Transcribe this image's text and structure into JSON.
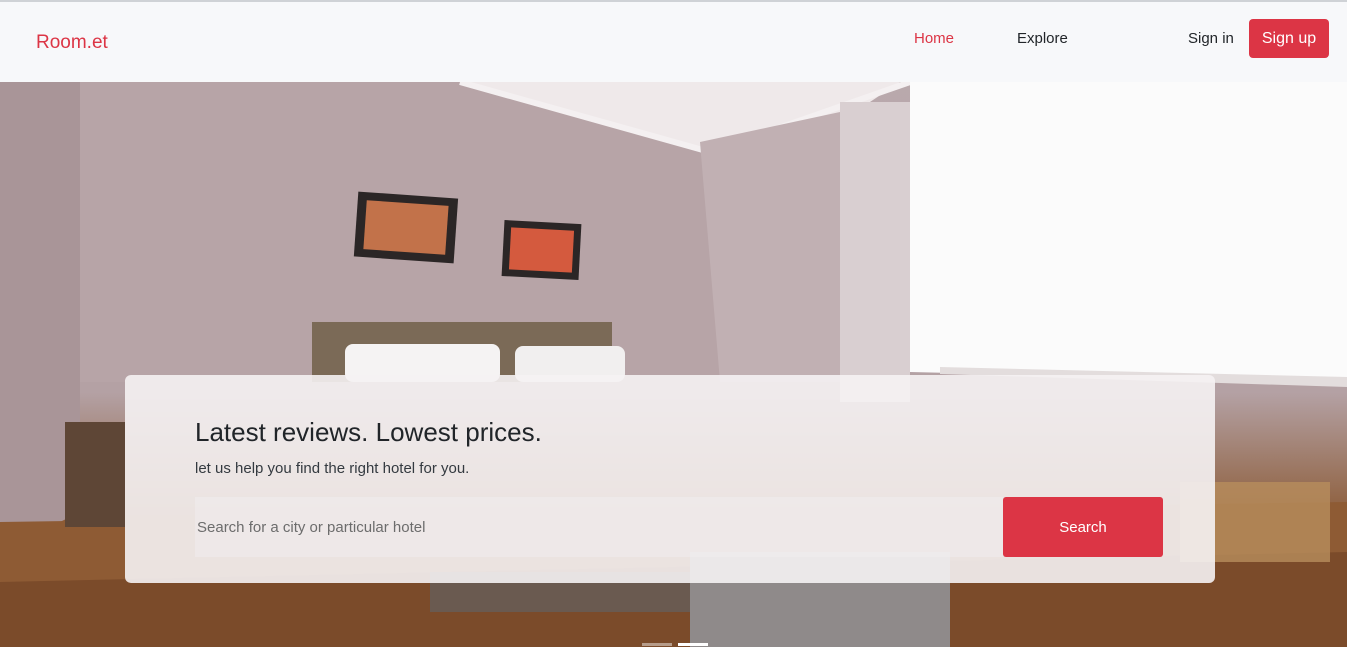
{
  "brand": "Room.et",
  "nav": {
    "home": "Home",
    "explore": "Explore",
    "sign_in": "Sign in",
    "sign_up": "Sign up"
  },
  "hero": {
    "title": "Latest reviews. Lowest prices.",
    "subtitle": "let us help you find the right hotel for you.",
    "search_placeholder": "Search for a city or particular hotel",
    "search_button": "Search",
    "slides_total": 2,
    "active_slide": 2
  },
  "colors": {
    "accent": "#dc3545",
    "nav_background": "#f7f8fa"
  }
}
